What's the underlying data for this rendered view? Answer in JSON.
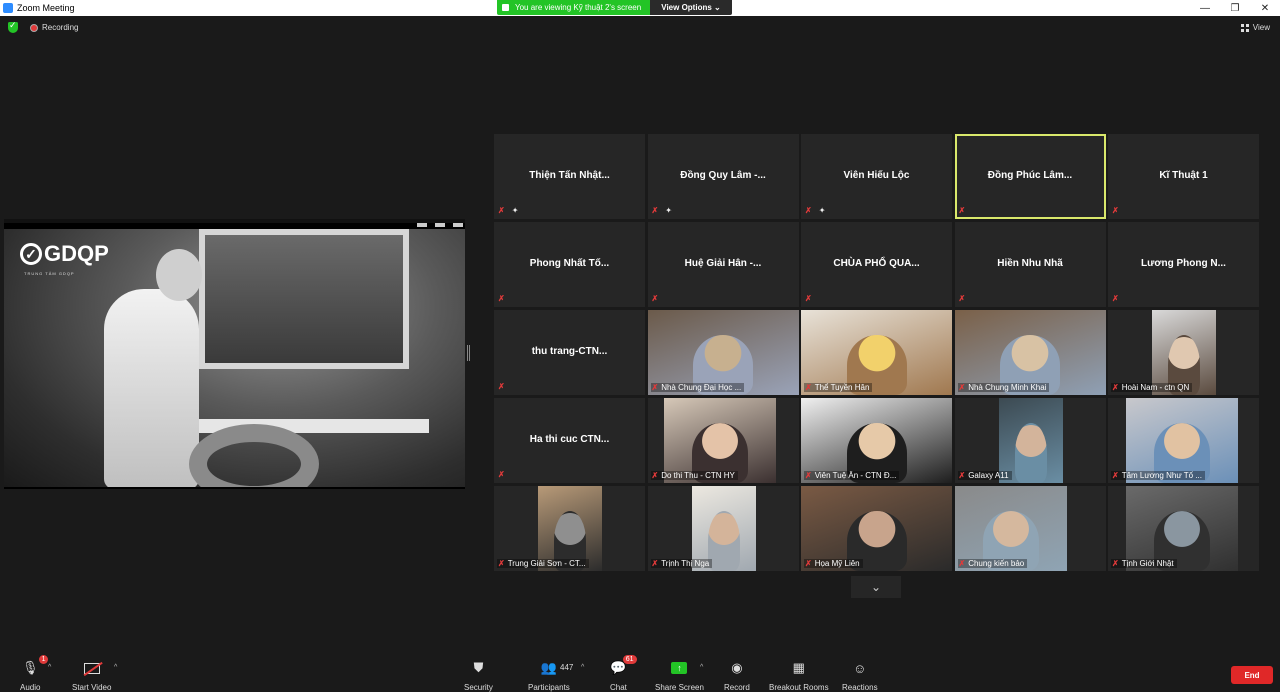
{
  "window": {
    "title": "Zoom Meeting",
    "minimize": "—",
    "restore": "❐",
    "close": "✕"
  },
  "share_banner": {
    "text": "You are viewing Kỹ thuật 2's screen",
    "view_options": "View Options ⌄"
  },
  "top": {
    "recording": "Recording",
    "view": "View"
  },
  "shared_screen": {
    "logo": "GDQP",
    "logo_sub": "TRUNG TÂM GDQP"
  },
  "tiles": [
    {
      "name": "Thiện Tấn Nhật...",
      "video": false,
      "pinned": true,
      "active": false
    },
    {
      "name": "Đồng Quy Lâm -...",
      "video": false,
      "pinned": true,
      "active": false
    },
    {
      "name": "Viên Hiếu Lộc",
      "video": false,
      "pinned": true,
      "active": false
    },
    {
      "name": "Đồng Phúc Lâm...",
      "video": false,
      "pinned": false,
      "active": true
    },
    {
      "name": "Kĩ Thuật 1",
      "video": false,
      "pinned": false,
      "active": false
    },
    {
      "name": "Phong Nhất Tố...",
      "video": false,
      "pinned": false,
      "active": false
    },
    {
      "name": "Huệ Giải Hân -...",
      "video": false,
      "pinned": false,
      "active": false
    },
    {
      "name": "CHÙA PHỔ QUA...",
      "video": false,
      "pinned": false,
      "active": false
    },
    {
      "name": "Hiền Nhu Nhã",
      "video": false,
      "pinned": false,
      "active": false
    },
    {
      "name": "Lương Phong N...",
      "video": false,
      "pinned": false,
      "active": false
    },
    {
      "name": "thu trang-CTN...",
      "video": false,
      "pinned": false,
      "active": false
    },
    {
      "name": "Nhà Chung Đại Học ...",
      "video": true
    },
    {
      "name": "Thể Tuyền Hân",
      "video": true
    },
    {
      "name": "Nhà Chung Minh Khai",
      "video": true
    },
    {
      "name": "Hoài Nam - ctn QN",
      "video": true
    },
    {
      "name": "Ha thi cuc CTN...",
      "video": false,
      "pinned": false,
      "active": false
    },
    {
      "name": "Do thi Thu - CTN HY",
      "video": true
    },
    {
      "name": "Viên Tuệ Ân - CTN Đ...",
      "video": true
    },
    {
      "name": "Galaxy A11",
      "video": true
    },
    {
      "name": "Tâm Lương Như Tố ...",
      "video": true
    },
    {
      "name": "Trung Giải Sơn - CT...",
      "video": true
    },
    {
      "name": "Trịnh Thị Nga",
      "video": true
    },
    {
      "name": "Họa Mỹ Liên",
      "video": true
    },
    {
      "name": "Chung kiến bảo",
      "video": true
    },
    {
      "name": "Tịnh Giới Nhật",
      "video": true
    }
  ],
  "toolbar": {
    "audio": "Audio",
    "audio_badge": "1",
    "start_video": "Start Video",
    "security": "Security",
    "participants": "Participants",
    "participants_count": "447",
    "chat": "Chat",
    "chat_badge": "61",
    "share_screen": "Share Screen",
    "record": "Record",
    "breakout_rooms": "Breakout Rooms",
    "reactions": "Reactions",
    "end": "End"
  },
  "colors": {
    "share_green": "#23c426",
    "end_red": "#e02828",
    "active_outline": "#d9e86b"
  }
}
